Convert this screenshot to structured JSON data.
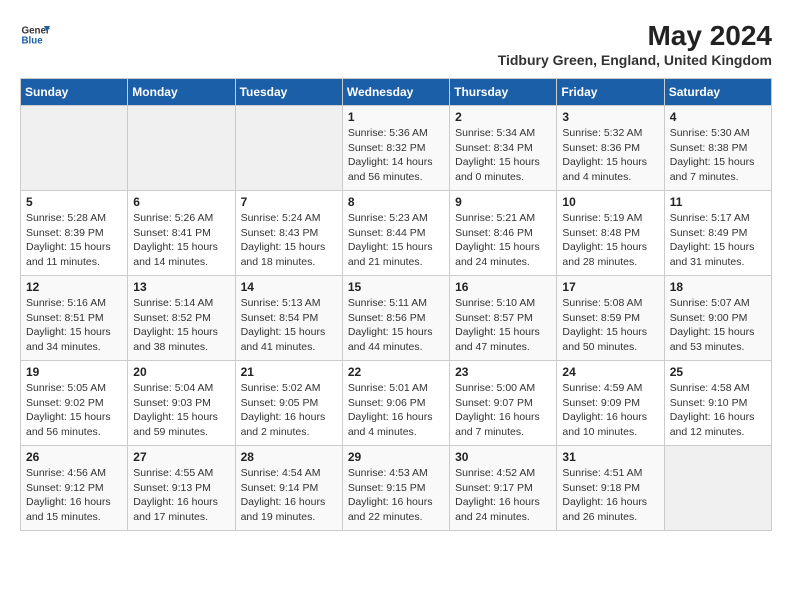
{
  "header": {
    "logo_line1": "General",
    "logo_line2": "Blue",
    "title": "May 2024",
    "subtitle": "Tidbury Green, England, United Kingdom"
  },
  "days_of_week": [
    "Sunday",
    "Monday",
    "Tuesday",
    "Wednesday",
    "Thursday",
    "Friday",
    "Saturday"
  ],
  "weeks": [
    [
      {
        "day": "",
        "info": ""
      },
      {
        "day": "",
        "info": ""
      },
      {
        "day": "",
        "info": ""
      },
      {
        "day": "1",
        "info": "Sunrise: 5:36 AM\nSunset: 8:32 PM\nDaylight: 14 hours\nand 56 minutes."
      },
      {
        "day": "2",
        "info": "Sunrise: 5:34 AM\nSunset: 8:34 PM\nDaylight: 15 hours\nand 0 minutes."
      },
      {
        "day": "3",
        "info": "Sunrise: 5:32 AM\nSunset: 8:36 PM\nDaylight: 15 hours\nand 4 minutes."
      },
      {
        "day": "4",
        "info": "Sunrise: 5:30 AM\nSunset: 8:38 PM\nDaylight: 15 hours\nand 7 minutes."
      }
    ],
    [
      {
        "day": "5",
        "info": "Sunrise: 5:28 AM\nSunset: 8:39 PM\nDaylight: 15 hours\nand 11 minutes."
      },
      {
        "day": "6",
        "info": "Sunrise: 5:26 AM\nSunset: 8:41 PM\nDaylight: 15 hours\nand 14 minutes."
      },
      {
        "day": "7",
        "info": "Sunrise: 5:24 AM\nSunset: 8:43 PM\nDaylight: 15 hours\nand 18 minutes."
      },
      {
        "day": "8",
        "info": "Sunrise: 5:23 AM\nSunset: 8:44 PM\nDaylight: 15 hours\nand 21 minutes."
      },
      {
        "day": "9",
        "info": "Sunrise: 5:21 AM\nSunset: 8:46 PM\nDaylight: 15 hours\nand 24 minutes."
      },
      {
        "day": "10",
        "info": "Sunrise: 5:19 AM\nSunset: 8:48 PM\nDaylight: 15 hours\nand 28 minutes."
      },
      {
        "day": "11",
        "info": "Sunrise: 5:17 AM\nSunset: 8:49 PM\nDaylight: 15 hours\nand 31 minutes."
      }
    ],
    [
      {
        "day": "12",
        "info": "Sunrise: 5:16 AM\nSunset: 8:51 PM\nDaylight: 15 hours\nand 34 minutes."
      },
      {
        "day": "13",
        "info": "Sunrise: 5:14 AM\nSunset: 8:52 PM\nDaylight: 15 hours\nand 38 minutes."
      },
      {
        "day": "14",
        "info": "Sunrise: 5:13 AM\nSunset: 8:54 PM\nDaylight: 15 hours\nand 41 minutes."
      },
      {
        "day": "15",
        "info": "Sunrise: 5:11 AM\nSunset: 8:56 PM\nDaylight: 15 hours\nand 44 minutes."
      },
      {
        "day": "16",
        "info": "Sunrise: 5:10 AM\nSunset: 8:57 PM\nDaylight: 15 hours\nand 47 minutes."
      },
      {
        "day": "17",
        "info": "Sunrise: 5:08 AM\nSunset: 8:59 PM\nDaylight: 15 hours\nand 50 minutes."
      },
      {
        "day": "18",
        "info": "Sunrise: 5:07 AM\nSunset: 9:00 PM\nDaylight: 15 hours\nand 53 minutes."
      }
    ],
    [
      {
        "day": "19",
        "info": "Sunrise: 5:05 AM\nSunset: 9:02 PM\nDaylight: 15 hours\nand 56 minutes."
      },
      {
        "day": "20",
        "info": "Sunrise: 5:04 AM\nSunset: 9:03 PM\nDaylight: 15 hours\nand 59 minutes."
      },
      {
        "day": "21",
        "info": "Sunrise: 5:02 AM\nSunset: 9:05 PM\nDaylight: 16 hours\nand 2 minutes."
      },
      {
        "day": "22",
        "info": "Sunrise: 5:01 AM\nSunset: 9:06 PM\nDaylight: 16 hours\nand 4 minutes."
      },
      {
        "day": "23",
        "info": "Sunrise: 5:00 AM\nSunset: 9:07 PM\nDaylight: 16 hours\nand 7 minutes."
      },
      {
        "day": "24",
        "info": "Sunrise: 4:59 AM\nSunset: 9:09 PM\nDaylight: 16 hours\nand 10 minutes."
      },
      {
        "day": "25",
        "info": "Sunrise: 4:58 AM\nSunset: 9:10 PM\nDaylight: 16 hours\nand 12 minutes."
      }
    ],
    [
      {
        "day": "26",
        "info": "Sunrise: 4:56 AM\nSunset: 9:12 PM\nDaylight: 16 hours\nand 15 minutes."
      },
      {
        "day": "27",
        "info": "Sunrise: 4:55 AM\nSunset: 9:13 PM\nDaylight: 16 hours\nand 17 minutes."
      },
      {
        "day": "28",
        "info": "Sunrise: 4:54 AM\nSunset: 9:14 PM\nDaylight: 16 hours\nand 19 minutes."
      },
      {
        "day": "29",
        "info": "Sunrise: 4:53 AM\nSunset: 9:15 PM\nDaylight: 16 hours\nand 22 minutes."
      },
      {
        "day": "30",
        "info": "Sunrise: 4:52 AM\nSunset: 9:17 PM\nDaylight: 16 hours\nand 24 minutes."
      },
      {
        "day": "31",
        "info": "Sunrise: 4:51 AM\nSunset: 9:18 PM\nDaylight: 16 hours\nand 26 minutes."
      },
      {
        "day": "",
        "info": ""
      }
    ]
  ]
}
